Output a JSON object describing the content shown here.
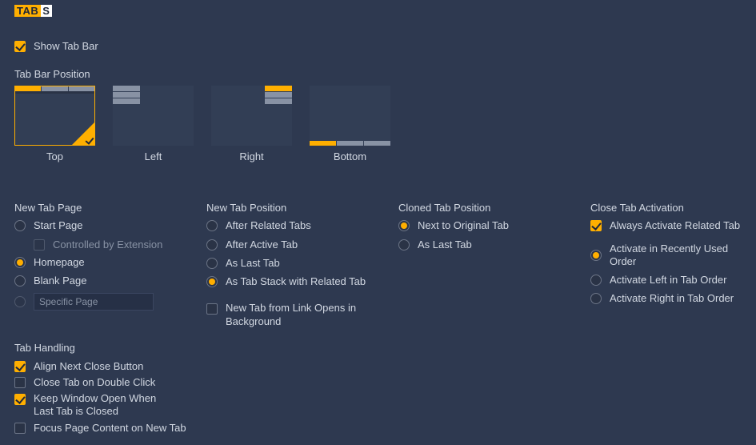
{
  "title": {
    "tab": "TAB",
    "s": "S"
  },
  "show_tab_bar": {
    "label": "Show Tab Bar",
    "checked": true
  },
  "tab_bar_position": {
    "label": "Tab Bar Position",
    "options": [
      {
        "label": "Top",
        "selected": true
      },
      {
        "label": "Left",
        "selected": false
      },
      {
        "label": "Right",
        "selected": false
      },
      {
        "label": "Bottom",
        "selected": false
      }
    ]
  },
  "new_tab_page": {
    "label": "New Tab Page",
    "options": [
      {
        "label": "Start Page",
        "selected": false
      },
      {
        "label": "Homepage",
        "selected": true
      },
      {
        "label": "Blank Page",
        "selected": false
      }
    ],
    "controlled_by_extension": {
      "label": "Controlled by Extension",
      "checked": false
    },
    "specific_page": {
      "placeholder": "Specific Page",
      "enabled": false
    }
  },
  "new_tab_position": {
    "label": "New Tab Position",
    "options": [
      {
        "label": "After Related Tabs",
        "selected": false
      },
      {
        "label": "After Active Tab",
        "selected": false
      },
      {
        "label": "As Last Tab",
        "selected": false
      },
      {
        "label": "As Tab Stack with Related Tab",
        "selected": true
      }
    ],
    "link_background": {
      "label": "New Tab from Link Opens in Background",
      "checked": false
    }
  },
  "cloned_tab_position": {
    "label": "Cloned Tab Position",
    "options": [
      {
        "label": "Next to Original Tab",
        "selected": true
      },
      {
        "label": "As Last Tab",
        "selected": false
      }
    ]
  },
  "close_tab_activation": {
    "label": "Close Tab Activation",
    "always_related": {
      "label": "Always Activate Related Tab",
      "checked": true
    },
    "options": [
      {
        "label": "Activate in Recently Used Order",
        "selected": true
      },
      {
        "label": "Activate Left in Tab Order",
        "selected": false
      },
      {
        "label": "Activate Right in Tab Order",
        "selected": false
      }
    ]
  },
  "tab_handling": {
    "label": "Tab Handling",
    "options": [
      {
        "label": "Align Next Close Button",
        "checked": true
      },
      {
        "label": "Close Tab on Double Click",
        "checked": false
      },
      {
        "label": "Keep Window Open When Last Tab is Closed",
        "checked": true
      },
      {
        "label": "Focus Page Content on New Tab",
        "checked": false
      }
    ]
  }
}
